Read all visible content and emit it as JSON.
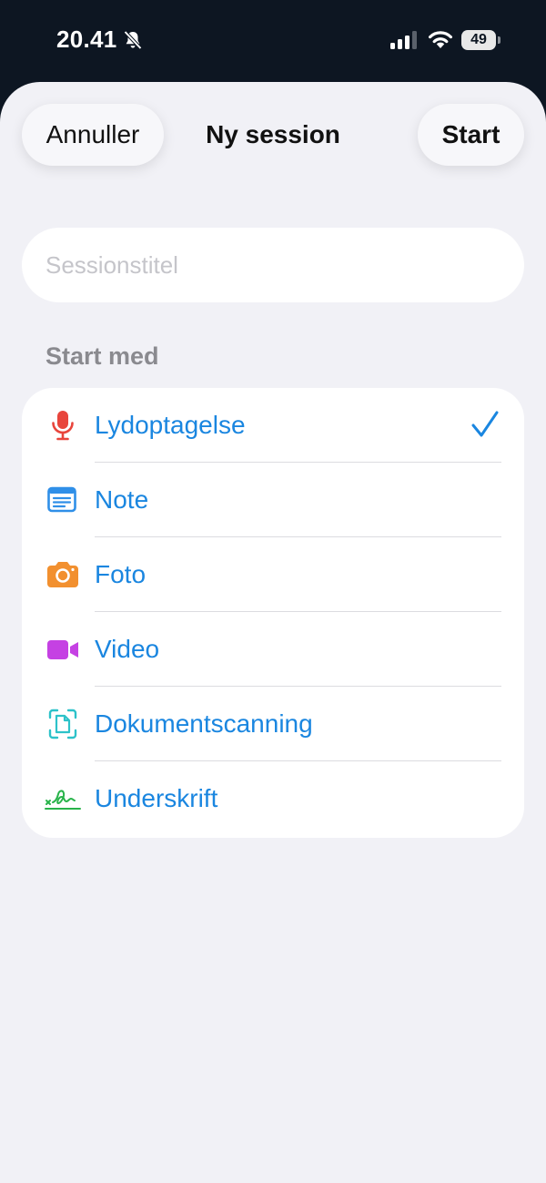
{
  "status_bar": {
    "time": "20.41",
    "battery": "49"
  },
  "nav": {
    "cancel_label": "Annuller",
    "title": "Ny session",
    "start_label": "Start"
  },
  "title_field": {
    "placeholder": "Sessionstitel",
    "value": ""
  },
  "start_with": {
    "header": "Start med",
    "selected": "Lydoptagelse",
    "options": [
      {
        "label": "Lydoptagelse",
        "icon": "microphone-icon",
        "color": "#e8453c"
      },
      {
        "label": "Note",
        "icon": "note-icon",
        "color": "#2f8fe8"
      },
      {
        "label": "Foto",
        "icon": "camera-icon",
        "color": "#f2902f"
      },
      {
        "label": "Video",
        "icon": "video-icon",
        "color": "#c541e3"
      },
      {
        "label": "Dokumentscanning",
        "icon": "document-scan-icon",
        "color": "#2dc2c9"
      },
      {
        "label": "Underskrift",
        "icon": "signature-icon",
        "color": "#28b34a"
      }
    ]
  },
  "colors": {
    "accent": "#1a86e0",
    "sheet_background": "#f1f1f6",
    "status_bar_background": "#0d1622"
  }
}
